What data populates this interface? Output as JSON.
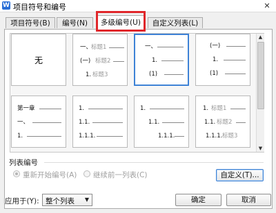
{
  "dialog": {
    "title": "项目符号和编号",
    "app_icon": "W",
    "close": "✕"
  },
  "tabs": [
    {
      "label": "项目符号(B)"
    },
    {
      "label": "编号(N)"
    },
    {
      "label": "多级编号(U)",
      "active": true
    },
    {
      "label": "自定义列表(L)"
    }
  ],
  "gallery": {
    "none_label": "无",
    "presets": [
      {
        "levels": [
          {
            "label": "一、",
            "text": "标题1"
          },
          {
            "label": "(一)",
            "text": "标题2"
          },
          {
            "label": "1.",
            "text": "标题3"
          }
        ]
      },
      {
        "levels": [
          {
            "label": "一、"
          },
          {
            "label": "1."
          },
          {
            "label": "(1)"
          }
        ],
        "selected": true
      },
      {
        "levels": [
          {
            "label": "(一)"
          },
          {
            "label": "1."
          },
          {
            "label": "(1)"
          }
        ]
      },
      {
        "levels": [
          {
            "label": "第一章"
          },
          {
            "label": "一、"
          },
          {
            "label": "1."
          }
        ]
      },
      {
        "levels": [
          {
            "label": "1."
          },
          {
            "label": "1.1."
          },
          {
            "label": "1.1.1."
          }
        ]
      },
      {
        "levels": [
          {
            "label": "1."
          },
          {
            "label": "1.1."
          },
          {
            "label": "1.1.1."
          }
        ]
      },
      {
        "levels": [
          {
            "label": "1.",
            "text": "标题1"
          },
          {
            "label": "1.1.",
            "text": "标题2"
          },
          {
            "label": "1.1.1.",
            "text": "标题3"
          }
        ]
      }
    ]
  },
  "list_numbering": {
    "section_label": "列表编号",
    "restart_label": "重新开始编号(A)",
    "continue_label": "继续前一列表(C)",
    "customize_button": "自定义(T)..."
  },
  "footer": {
    "apply_label": "应用于(Y):",
    "apply_value": "整个列表",
    "ok_button": "确定",
    "cancel_button": "取消"
  }
}
